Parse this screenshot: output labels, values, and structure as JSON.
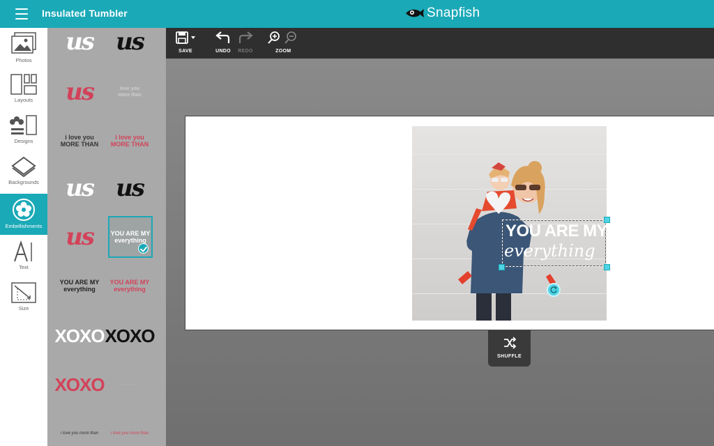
{
  "topbar": {
    "title": "Insulated Tumbler",
    "brand": "Snapfish"
  },
  "rail": [
    {
      "label": "Photos",
      "icon": "photos-icon"
    },
    {
      "label": "Layouts",
      "icon": "layouts-icon"
    },
    {
      "label": "Designs",
      "icon": "designs-icon"
    },
    {
      "label": "Backgrounds",
      "icon": "backgrounds-icon"
    },
    {
      "label": "Embellishments",
      "icon": "embellishments-icon",
      "active": true
    },
    {
      "label": "Text",
      "icon": "text-icon"
    },
    {
      "label": "Size",
      "icon": "size-icon"
    }
  ],
  "panel": {
    "items": [
      {
        "text": "us",
        "color": "#ffffff"
      },
      {
        "text": "us",
        "color": "#111111"
      },
      {
        "text": "us",
        "color": "#d2435a"
      },
      {
        "text": "love you\nmore than",
        "color": "#cfcfcf"
      },
      {
        "text": "i love you\nMORE THAN",
        "color": "#333333"
      },
      {
        "text": "i love you\nMORE THAN",
        "color": "#d2435a"
      },
      {
        "text": "us",
        "color": "#ffffff"
      },
      {
        "text": "us",
        "color": "#111111"
      },
      {
        "text": "us",
        "color": "#d2435a"
      },
      {
        "text": "YOU ARE MY\neverything",
        "color": "#ffffff",
        "selected": true
      },
      {
        "text": "YOU ARE MY\neverything",
        "color": "#222222"
      },
      {
        "text": "YOU ARE MY\neverything",
        "color": "#d2435a"
      },
      {
        "text": "XOXO",
        "color": "#ffffff"
      },
      {
        "text": "XOXO",
        "color": "#111111"
      },
      {
        "text": "XOXO",
        "color": "#d2435a"
      },
      {
        "text": "· · · · · · · ·",
        "color": "#cfcfcf"
      },
      {
        "text": "i love you more than",
        "color": "#333333"
      },
      {
        "text": "i love you more than",
        "color": "#d2435a"
      }
    ]
  },
  "toolbar": {
    "save": "SAVE",
    "undo": "UNDO",
    "redo": "REDO",
    "zoom": "ZOOM"
  },
  "canvas": {
    "overlay_line1": "YOU ARE MY",
    "overlay_line2": "everything"
  },
  "shuffle": {
    "label": "SHUFFLE"
  },
  "colors": {
    "accent": "#1aa9b7",
    "toolbar": "#2f2f2f",
    "pink": "#d2435a"
  }
}
